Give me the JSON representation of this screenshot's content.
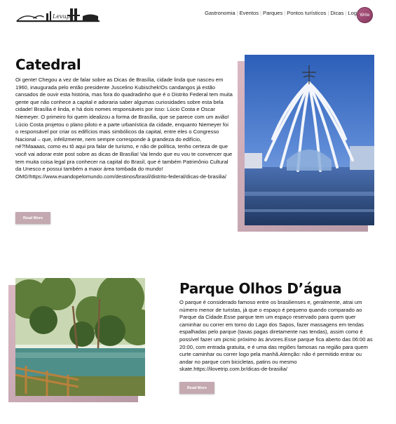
{
  "header": {
    "logo_text": "Levup",
    "nav": [
      {
        "label": "Gastronomia"
      },
      {
        "label": "Eventos"
      },
      {
        "label": "Parques"
      },
      {
        "label": "Pontos turísticos"
      },
      {
        "label": "Dicas"
      },
      {
        "label": "Login"
      }
    ],
    "write_label": "Write"
  },
  "articles": [
    {
      "title": "Catedral",
      "body": "Oi gente! Chegou a vez de falar sobre as Dicas de Brasília, cidade linda que nasceu em 1960, inaugurada pelo então presidente Juscelino Kubischek!Os candangos já estão cansados de ouvir esta história, mas fora do quadradinho que é o Distrito Federal tem muita gente que não conhece a capital e adoraria saber algumas curiosidades sobre esta bela cidade! Brasília é linda, e há dois nomes responsáveis por isso: Lúcio Costa e Oscar Niemeyer. O primeiro foi quem idealizou a forma de Brasília, que se parece com um avião! Lúcio Costa projetou o plano piloto e a parte urbanística da cidade, enquanto Niemeyer foi o responsável por criar os edifícios mais simbólicos da capital, entre eles o Congresso Nacional – que, infelizmente, nem sempre corresponde à grandeza do edifício, né?!Maaaas, como eu tô aqui pra falar de turismo, e não de política, tenho certeza de que você vai adorar este post sobre as dicas de Brasília! Vai lendo que eu vou te convencer que tem muita coisa legal pra conhecer na capital do Brasil, que é também Patrimônio Cultural da Unesco e possui também a maior área tombada do mundo! OMG!https://www.euandopelomundo.com/destinos/brasil/distrito-federal/dicas-de-brasilia/",
      "button": "Read More",
      "image_desc": "cathedral-photo"
    },
    {
      "title": "Parque Olhos D’água",
      "body": "O parque é considerado famoso entre os brasilienses e, geralmente, atrai um número menor de turistas, já que o espaço é pequeno quando comparado ao Parque da Cidade.Esse parque tem um espaço reservado para quem quer caminhar ou correr em torno do Lago dos Sapos, fazer massagens em tendas espalhadas pelo parque (taxas pagas diretamente nas tendas), assim como é possível fazer um picnic próximo às árvores.Esse parque fica aberto das 06:00 as 20:00, com entrada gratuita, e é uma das regiões famosas na região para quem curte caminhar ou correr logo pela manhã.Atenção: não é permitido entrar ou andar no parque com bicicletas, patins ou mesmo skate.https://ilovetrip.com.br/dicas-de-brasilia/",
      "button": "Read More",
      "image_desc": "park-photo"
    }
  ],
  "colors": {
    "accent": "#c4a9b1",
    "write_button": "#9c4a72",
    "image_shadow": "#cfb0bb"
  }
}
